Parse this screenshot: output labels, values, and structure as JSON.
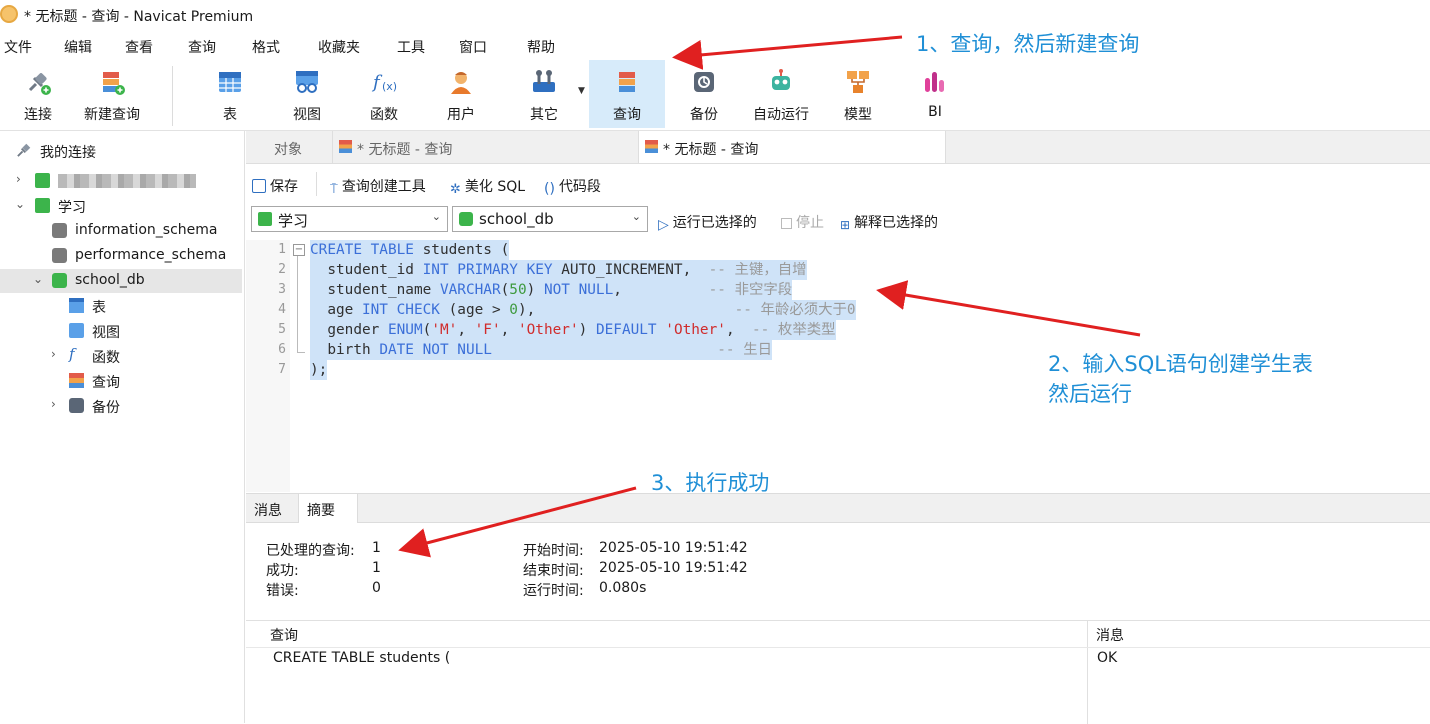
{
  "window": {
    "title": "* 无标题 - 查询 - Navicat Premium"
  },
  "menu": [
    "文件",
    "编辑",
    "查看",
    "查询",
    "格式",
    "收藏夹",
    "工具",
    "窗口",
    "帮助"
  ],
  "toolbar": {
    "items": [
      {
        "label": "连接",
        "icon": "connection-icon"
      },
      {
        "label": "新建查询",
        "icon": "new-query-icon"
      },
      {
        "label": "表",
        "icon": "table-icon"
      },
      {
        "label": "视图",
        "icon": "view-icon"
      },
      {
        "label": "函数",
        "icon": "function-icon"
      },
      {
        "label": "用户",
        "icon": "user-icon"
      },
      {
        "label": "其它",
        "icon": "other-icon"
      },
      {
        "label": "查询",
        "icon": "query-icon"
      },
      {
        "label": "备份",
        "icon": "backup-icon"
      },
      {
        "label": "自动运行",
        "icon": "automation-icon"
      },
      {
        "label": "模型",
        "icon": "model-icon"
      },
      {
        "label": "BI",
        "icon": "bi-icon"
      }
    ]
  },
  "sidebar": {
    "header": "我的连接",
    "tree": [
      {
        "label": "",
        "blurred": true
      },
      {
        "label": "学习"
      },
      {
        "label": "information_schema"
      },
      {
        "label": "performance_schema"
      },
      {
        "label": "school_db"
      },
      {
        "label": "表"
      },
      {
        "label": "视图"
      },
      {
        "label": "函数"
      },
      {
        "label": "查询"
      },
      {
        "label": "备份"
      }
    ]
  },
  "tabs": [
    {
      "label": "对象"
    },
    {
      "label": "* 无标题 - 查询"
    },
    {
      "label": "* 无标题 - 查询"
    }
  ],
  "query_toolbar": {
    "save": "保存",
    "builder": "查询创建工具",
    "beautify": "美化 SQL",
    "snippet": "代码段",
    "connection": "学习",
    "database": "school_db",
    "run_selected": "运行已选择的",
    "stop": "停止",
    "explain_selected": "解释已选择的"
  },
  "editor": {
    "line_numbers": [
      "1",
      "2",
      "3",
      "4",
      "5",
      "6",
      "7"
    ]
  },
  "result_tabs": [
    "消息",
    "摘要"
  ],
  "summary": {
    "processed_label": "已处理的查询:",
    "processed_value": "1",
    "success_label": "成功:",
    "success_value": "1",
    "error_label": "错误:",
    "error_value": "0",
    "start_label": "开始时间:",
    "start_value": "2025-05-10 19:51:42",
    "end_label": "结束时间:",
    "end_value": "2025-05-10 19:51:42",
    "elapsed_label": "运行时间:",
    "elapsed_value": "0.080s"
  },
  "result_table": {
    "headers": [
      "查询",
      "消息"
    ],
    "rows": [
      {
        "query": "CREATE TABLE students (",
        "message": "OK"
      }
    ]
  },
  "annotations": {
    "step1": "1、查询，然后新建查询",
    "step2_line1": "2、输入SQL语句创建学生表",
    "step2_line2": "然后运行",
    "step3": "3、执行成功",
    "color": "#1f8fd6",
    "arrow_color": "#e02020"
  },
  "colors": {
    "keyword": "#3b6fd8",
    "string": "#d02c2c",
    "comment": "#9a9a9a",
    "selection": "#cfe3f8",
    "active_tool": "#d7ebfa"
  }
}
